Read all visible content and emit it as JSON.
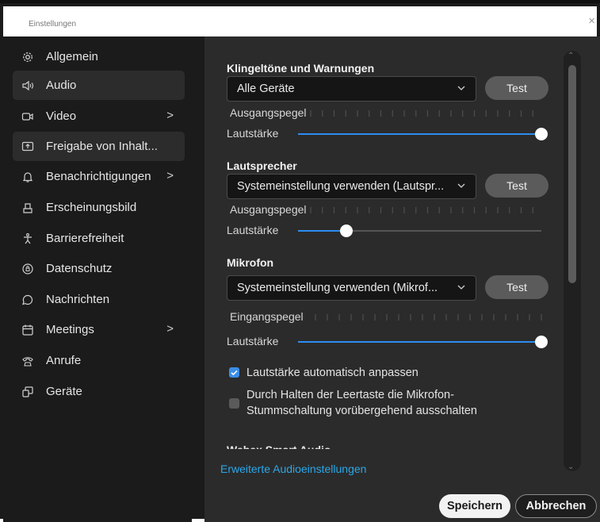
{
  "window": {
    "title": "Einstellungen",
    "close": "×"
  },
  "sidebar": {
    "items": [
      {
        "label": "Allgemein",
        "icon": "gear-icon"
      },
      {
        "label": "Audio",
        "icon": "speaker-icon",
        "selected": true
      },
      {
        "label": "Video",
        "icon": "camera-icon",
        "chevron": ">"
      },
      {
        "label": "Freigabe von Inhalt...",
        "icon": "share-screen-icon",
        "selected": true
      },
      {
        "label": "Benachrichtigungen",
        "icon": "bell-icon",
        "chevron": ">"
      },
      {
        "label": "Erscheinungsbild",
        "icon": "appearance-icon"
      },
      {
        "label": "Barrierefreiheit",
        "icon": "accessibility-icon"
      },
      {
        "label": "Datenschutz",
        "icon": "privacy-icon"
      },
      {
        "label": "Nachrichten",
        "icon": "chat-icon"
      },
      {
        "label": "Meetings",
        "icon": "calendar-icon",
        "chevron": ">"
      },
      {
        "label": "Anrufe",
        "icon": "phone-icon"
      },
      {
        "label": "Geräte",
        "icon": "devices-icon"
      }
    ]
  },
  "ringtones": {
    "title": "Klingeltöne und Warnungen",
    "device": "Alle Geräte",
    "test": "Test",
    "level_label": "Ausgangspegel",
    "volume_label": "Lautstärke",
    "volume": 1.0
  },
  "speaker": {
    "title": "Lautsprecher",
    "device": "Systemeinstellung verwenden (Lautspr...",
    "test": "Test",
    "level_label": "Ausgangspegel",
    "volume_label": "Lautstärke",
    "volume": 0.2
  },
  "microphone": {
    "title": "Mikrofon",
    "device": "Systemeinstellung verwenden (Mikrof...",
    "test": "Test",
    "level_label": "Eingangspegel",
    "volume_label": "Lautstärke",
    "volume": 1.0,
    "auto_adjust": {
      "label": "Lautstärke automatisch anpassen",
      "checked": true
    },
    "space_unmute": {
      "label_line1": "Durch Halten der Leertaste die Mikrofon-",
      "label_line2": "Stummschaltung vorübergehend ausschalten",
      "checked": false
    }
  },
  "next_section_partial": "Webex Smart Audio",
  "footer": {
    "advanced_link": "Erweiterte Audioeinstellungen",
    "save": "Speichern",
    "cancel": "Abbrechen"
  },
  "colors": {
    "accent": "#2d8cf0",
    "link": "#2aa7e8",
    "panel": "#2b2b2b",
    "sidebar": "#1b1b1b"
  }
}
